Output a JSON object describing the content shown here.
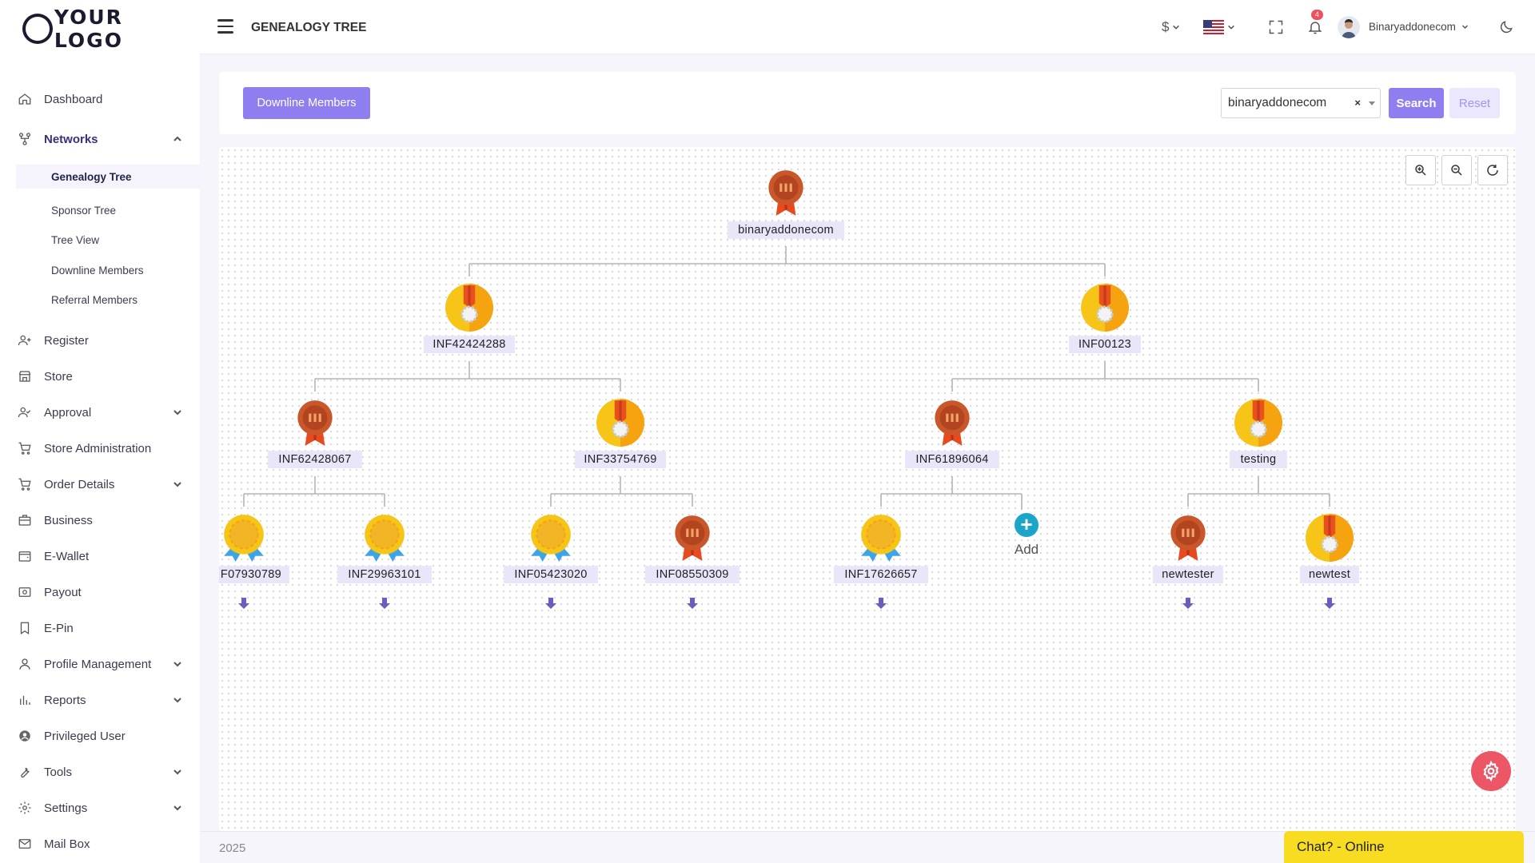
{
  "brand": {
    "logo_text": "YOUR LOGO"
  },
  "header": {
    "title": "GENEALOGY TREE",
    "currency_symbol": "$",
    "notifications_count": "4",
    "user_name": "Binaryaddonecom"
  },
  "sidebar": {
    "items": [
      {
        "label": "Dashboard",
        "icon": "home-icon"
      },
      {
        "label": "Networks",
        "icon": "network-icon"
      },
      {
        "label": "Register",
        "icon": "user-plus-icon"
      },
      {
        "label": "Store",
        "icon": "store-icon"
      },
      {
        "label": "Approval",
        "icon": "user-check-icon"
      },
      {
        "label": "Store Administration",
        "icon": "cart-icon"
      },
      {
        "label": "Order Details",
        "icon": "cart-icon"
      },
      {
        "label": "Business",
        "icon": "briefcase-icon"
      },
      {
        "label": "E-Wallet",
        "icon": "wallet-icon"
      },
      {
        "label": "Payout",
        "icon": "payout-icon"
      },
      {
        "label": "E-Pin",
        "icon": "bookmark-icon"
      },
      {
        "label": "Profile Management",
        "icon": "user-icon"
      },
      {
        "label": "Reports",
        "icon": "bar-chart-icon"
      },
      {
        "label": "Privileged User",
        "icon": "user-circle-icon"
      },
      {
        "label": "Tools",
        "icon": "wrench-icon"
      },
      {
        "label": "Settings",
        "icon": "gear-icon"
      },
      {
        "label": "Mail Box",
        "icon": "mail-icon"
      }
    ],
    "networks_sub": [
      "Genealogy Tree",
      "Sponsor Tree",
      "Tree View",
      "Downline Members",
      "Referral Members"
    ]
  },
  "toolbar": {
    "downline_label": "Downline Members",
    "selected_user": "binaryaddonecom",
    "clear_symbol": "×",
    "search_label": "Search",
    "reset_label": "Reset"
  },
  "tree": {
    "root": "binaryaddonecom",
    "level1": [
      "INF42424288",
      "INF00123"
    ],
    "level2": [
      "INF62428067",
      "INF33754769",
      "INF61896064",
      "testing"
    ],
    "level3": [
      "F07930789",
      "INF29963101",
      "INF05423020",
      "INF08550309",
      "INF17626657",
      "newtester",
      "newtest"
    ],
    "add_label": "Add",
    "colors": {
      "bronze": "#c9572a",
      "gold": "#f7c518",
      "ribbon": "#e8501f",
      "add": "#1ba6c9",
      "arrow": "#6c5bc0"
    }
  },
  "footer": {
    "year": "2025",
    "chat_label": "Chat? - Online"
  }
}
